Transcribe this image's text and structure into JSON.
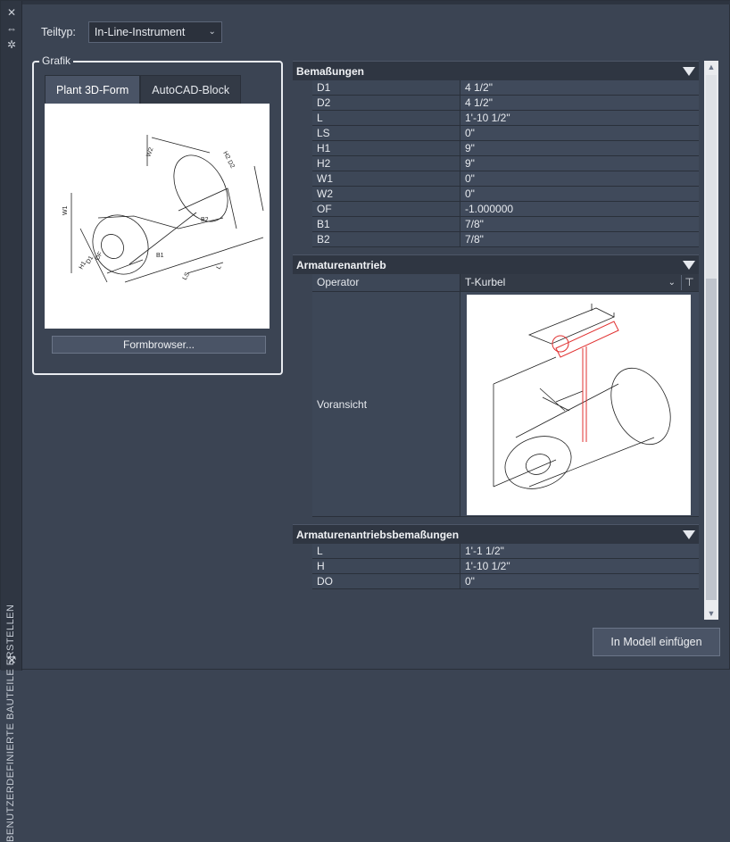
{
  "sidebar": {
    "vertical_title": "BENUTZERDEFINIERTE BAUTEILE ERSTELLEN",
    "icons": [
      "close-icon",
      "pin-icon",
      "settings-icon",
      "palette-icon"
    ]
  },
  "teiltyp": {
    "label": "Teiltyp:",
    "value": "In-Line-Instrument"
  },
  "grafik": {
    "legend": "Grafik",
    "tabs": [
      {
        "label": "Plant 3D-Form",
        "active": true
      },
      {
        "label": "AutoCAD-Block",
        "active": false
      }
    ],
    "formbrowser_label": "Formbrowser..."
  },
  "bemassungen": {
    "title": "Bemaßungen",
    "rows": [
      {
        "key": "D1",
        "value": "4 1/2\""
      },
      {
        "key": "D2",
        "value": "4 1/2\""
      },
      {
        "key": "L",
        "value": "1'-10 1/2\""
      },
      {
        "key": "LS",
        "value": "0\""
      },
      {
        "key": "H1",
        "value": "9\""
      },
      {
        "key": "H2",
        "value": "9\""
      },
      {
        "key": "W1",
        "value": "0\""
      },
      {
        "key": "W2",
        "value": "0\""
      },
      {
        "key": "OF",
        "value": "-1.000000"
      },
      {
        "key": "B1",
        "value": "7/8\""
      },
      {
        "key": "B2",
        "value": "7/8\""
      }
    ]
  },
  "antrieb": {
    "title": "Armaturenantrieb",
    "operator_label": "Operator",
    "operator_value": "T-Kurbel",
    "preview_label": "Voransicht"
  },
  "antrieb_bemassungen": {
    "title": "Armaturenantriebsbemaßungen",
    "rows": [
      {
        "key": "L",
        "value": "1'-1 1/2\""
      },
      {
        "key": "H",
        "value": "1'-10 1/2\""
      },
      {
        "key": "DO",
        "value": "0\""
      }
    ]
  },
  "insert_button": "In Modell einfügen",
  "colors": {
    "background": "#3b4453",
    "panel_dark": "#2f3642",
    "accent_red": "#e03030"
  }
}
